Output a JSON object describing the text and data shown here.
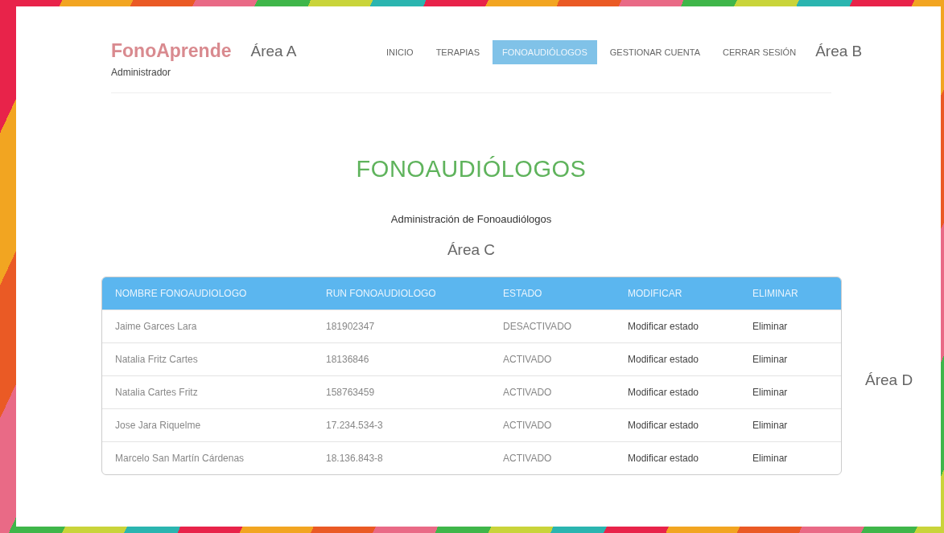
{
  "header": {
    "brand": "FonoAprende",
    "role": "Administrador",
    "area_label": "Área A"
  },
  "nav": {
    "items": [
      {
        "label": "INICIO",
        "selected": false
      },
      {
        "label": "TERAPIAS",
        "selected": false
      },
      {
        "label": "FONOAUDIÓLOGOS",
        "selected": true
      },
      {
        "label": "GESTIONAR CUENTA",
        "selected": false
      },
      {
        "label": "CERRAR SESIÓN",
        "selected": false
      }
    ],
    "area_label": "Área B"
  },
  "page": {
    "title": "FONOAUDIÓLOGOS",
    "subtitle": "Administración de Fonoaudiólogos",
    "area_label": "Área C"
  },
  "table": {
    "columns": [
      "NOMBRE FONOAUDIOLOGO",
      "RUN FONOAUDIOLOGO",
      "ESTADO",
      "MODIFICAR",
      "ELIMINAR"
    ],
    "rows": [
      {
        "name": "Jaime Garces Lara",
        "run": "181902347",
        "status": "DESACTIVADO",
        "modify": "Modificar estado",
        "delete": "Eliminar"
      },
      {
        "name": "Natalia Fritz Cartes",
        "run": "18136846",
        "status": "ACTIVADO",
        "modify": "Modificar estado",
        "delete": "Eliminar"
      },
      {
        "name": "Natalia Cartes Fritz",
        "run": "158763459",
        "status": "ACTIVADO",
        "modify": "Modificar estado",
        "delete": "Eliminar"
      },
      {
        "name": "Jose Jara Riquelme",
        "run": "17.234.534-3",
        "status": "ACTIVADO",
        "modify": "Modificar estado",
        "delete": "Eliminar"
      },
      {
        "name": "Marcelo San Martín Cárdenas",
        "run": "18.136.843-8",
        "status": "ACTIVADO",
        "modify": "Modificar estado",
        "delete": "Eliminar"
      }
    ],
    "area_label": "Área D"
  }
}
